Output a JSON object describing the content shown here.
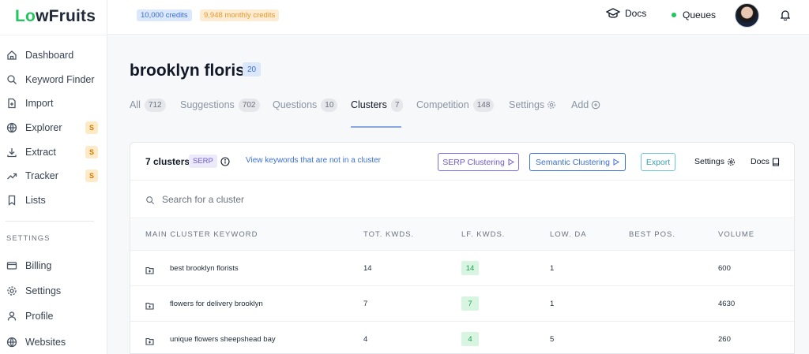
{
  "app": {
    "logo_prefix": "Lo",
    "logo_suffix": "wFruits",
    "accent": "#22c55e"
  },
  "sidebar": {
    "items": [
      {
        "label": "Dashboard",
        "icon": "home-icon"
      },
      {
        "label": "Keyword Finder",
        "icon": "search-icon"
      },
      {
        "label": "Import",
        "icon": "file-plus-icon"
      },
      {
        "label": "Explorer",
        "icon": "globe-icon",
        "badge": "S"
      },
      {
        "label": "Extract",
        "icon": "download-icon",
        "badge": "S"
      },
      {
        "label": "Tracker",
        "icon": "trend-icon",
        "badge": "S"
      },
      {
        "label": "Lists",
        "icon": "bookmark-icon"
      }
    ],
    "settings_heading": "SETTINGS",
    "settings_items": [
      {
        "label": "Billing",
        "icon": "card-icon"
      },
      {
        "label": "Settings",
        "icon": "gear-icon"
      },
      {
        "label": "Profile",
        "icon": "user-icon"
      },
      {
        "label": "Websites",
        "icon": "globe-icon"
      }
    ]
  },
  "topbar": {
    "credits": "10,000 credits",
    "monthly_credits": "9,948 monthly credits",
    "docs_label": "Docs",
    "queues_label": "Queues"
  },
  "page": {
    "title": "brooklyn florist",
    "title_count": "20",
    "tabs": [
      {
        "label": "All",
        "count": "712"
      },
      {
        "label": "Suggestions",
        "count": "702"
      },
      {
        "label": "Questions",
        "count": "10"
      },
      {
        "label": "Clusters",
        "count": "7",
        "active": true
      },
      {
        "label": "Competition",
        "count": "148"
      },
      {
        "label": "Settings"
      },
      {
        "label": "Add"
      }
    ]
  },
  "clusters": {
    "count_label": "7 clusters",
    "serp_tag": "SERP",
    "view_link": "View keywords that are not in a cluster",
    "serp_button": "SERP Clustering",
    "semantic_button": "Semantic Clustering",
    "export_button": "Export",
    "settings_link": "Settings",
    "docs_link": "Docs",
    "search_placeholder": "Search for a cluster",
    "columns": [
      "MAIN CLUSTER KEYWORD",
      "TOT. KWDS.",
      "LF. KWDS.",
      "LOW. DA",
      "BEST POS.",
      "VOLUME"
    ],
    "rows": [
      {
        "keyword": "best brooklyn florists",
        "tot": "14",
        "lf": "14",
        "low_da": "1",
        "best_pos": "",
        "volume": "600"
      },
      {
        "keyword": "flowers for delivery brooklyn",
        "tot": "7",
        "lf": "7",
        "low_da": "1",
        "best_pos": "",
        "volume": "4630"
      },
      {
        "keyword": "unique flowers sheepshead bay",
        "tot": "4",
        "lf": "4",
        "low_da": "5",
        "best_pos": "",
        "volume": "260"
      }
    ]
  }
}
